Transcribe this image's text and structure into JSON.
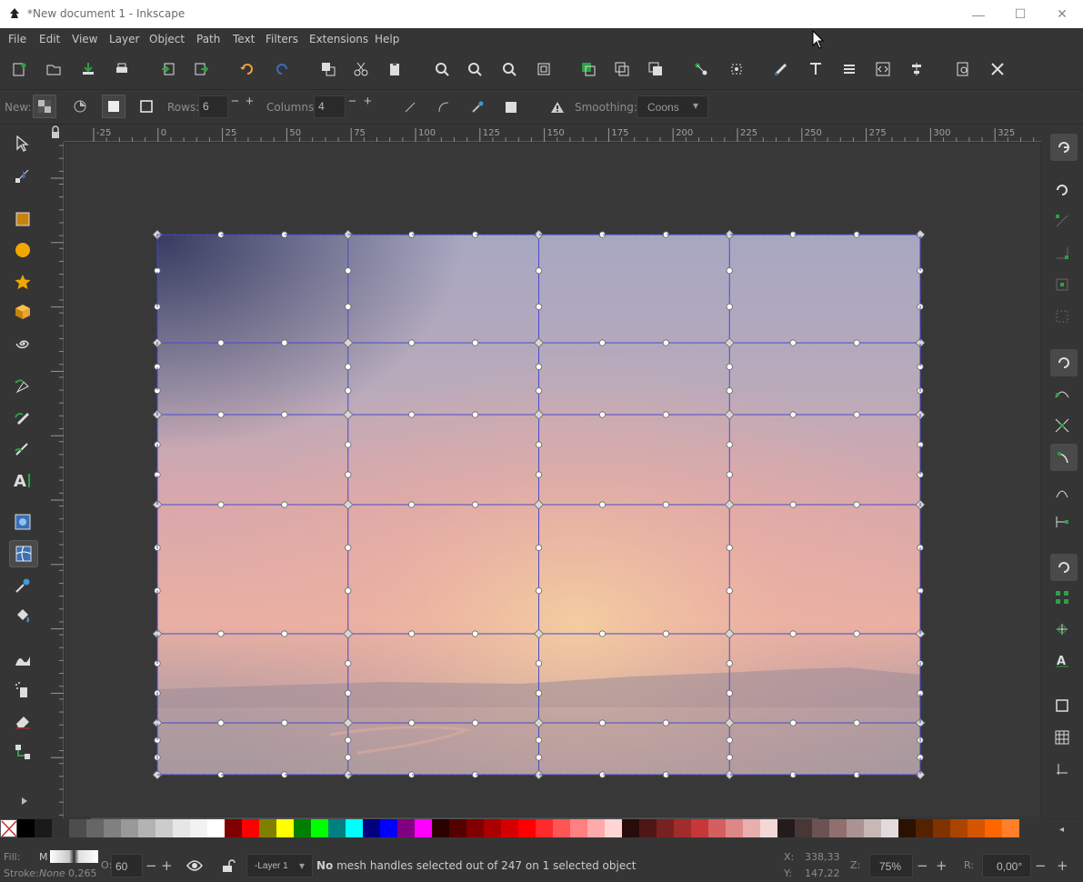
{
  "window": {
    "title": "*New document 1 - Inkscape"
  },
  "menu": [
    "File",
    "Edit",
    "View",
    "Layer",
    "Object",
    "Path",
    "Text",
    "Filters",
    "Extensions",
    "Help"
  ],
  "tool_controls": {
    "new_label": "New:",
    "rows_label": "Rows:",
    "rows_value": "6",
    "columns_label": "Columns:",
    "columns_value": "4",
    "smoothing_label": "Smoothing:",
    "smoothing_value": "Coons"
  },
  "ruler_top": [
    "-25",
    "0",
    "25",
    "50",
    "75",
    "100",
    "125",
    "150",
    "175",
    "200",
    "225",
    "250",
    "275",
    "300",
    "325"
  ],
  "status": {
    "fill_label": "Fill:",
    "fill_value": "M",
    "stroke_label": "Stroke:",
    "stroke_value": "None",
    "stroke_width": "0,265",
    "opacity_label": "O:",
    "opacity_value": "60",
    "layer": "-Layer 1",
    "message_bold": "No",
    "message_rest": " mesh handles selected out of 247 on 1 selected object",
    "x_label": "X:",
    "x_value": "338,33",
    "y_label": "Y:",
    "y_value": "147,22",
    "zoom_label": "Z:",
    "zoom_value": "75%",
    "rot_label": "R:",
    "rot_value": "0,00°"
  },
  "palette": [
    "#ffffff",
    "#000000",
    "#1a1a1a",
    "#333333",
    "#4d4d4d",
    "#666666",
    "#808080",
    "#999999",
    "#b3b3b3",
    "#cccccc",
    "#e6e6e6",
    "#f2f2f2",
    "#ffffff",
    "#800000",
    "#ff0000",
    "#808000",
    "#ffff00",
    "#008000",
    "#00ff00",
    "#008080",
    "#00ffff",
    "#000080",
    "#0000ff",
    "#800080",
    "#ff00ff",
    "#2b0000",
    "#550000",
    "#800000",
    "#aa0000",
    "#d40000",
    "#ff0000",
    "#ff2a2a",
    "#ff5555",
    "#ff8080",
    "#ffaaaa",
    "#ffd5d5",
    "#280b0b",
    "#501616",
    "#782121",
    "#a02c2c",
    "#c83737",
    "#d35f5f",
    "#de8787",
    "#e9afaf",
    "#f4d7d7",
    "#241c1c",
    "#483737",
    "#6c5353",
    "#916f6f",
    "#ac9393",
    "#c8b7b7",
    "#e3dbdb",
    "#2b1100",
    "#552200",
    "#803300",
    "#aa4400",
    "#d45500",
    "#ff6600",
    "#ff7f2a"
  ]
}
